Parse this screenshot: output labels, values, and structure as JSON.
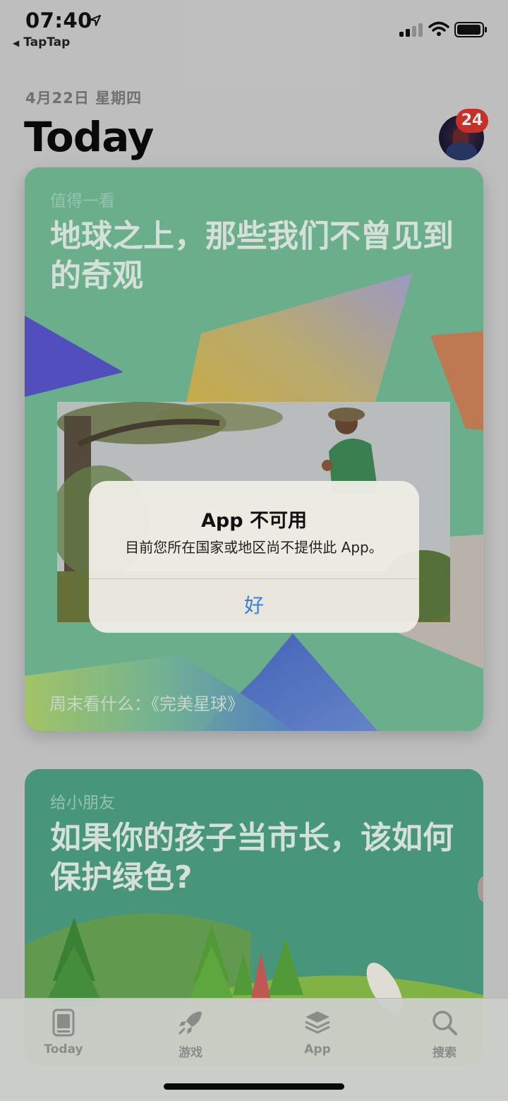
{
  "status": {
    "time": "07:40",
    "back_app": "TapTap",
    "battery_percent": 90
  },
  "header": {
    "date": "4月22日 星期四",
    "title": "Today",
    "badge_count": "24"
  },
  "cards": [
    {
      "eyebrow": "值得一看",
      "headline": "地球之上，那些我们不曾见到的奇观",
      "footer": "周末看什么：《完美星球》"
    },
    {
      "eyebrow": "给小朋友",
      "headline": "如果你的孩子当市长，该如何保护绿色?"
    }
  ],
  "alert": {
    "title": "App 不可用",
    "message": "目前您所在国家或地区尚不提供此 App。",
    "ok_label": "好"
  },
  "tabbar": {
    "tabs": [
      {
        "label": "Today",
        "icon": "today-icon"
      },
      {
        "label": "游戏",
        "icon": "rocket-icon"
      },
      {
        "label": "App",
        "icon": "layers-icon"
      },
      {
        "label": "搜索",
        "icon": "search-icon"
      }
    ]
  },
  "colors": {
    "card1_bg": "#6fb796",
    "card2_bg": "#4aa183",
    "badge": "#d9342b",
    "alert_button": "#3a7fd6"
  }
}
